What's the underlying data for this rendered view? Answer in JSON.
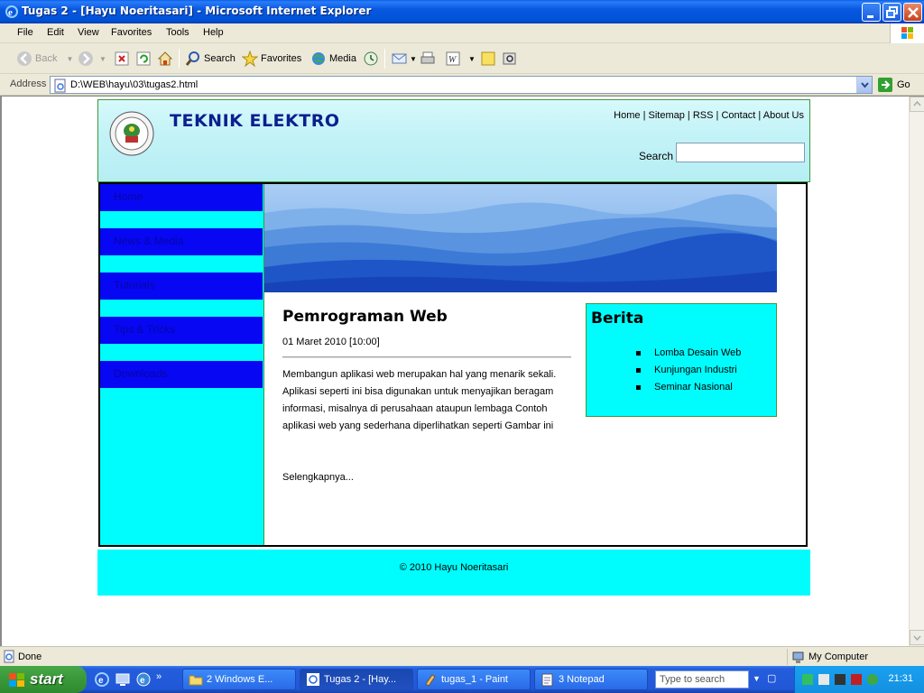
{
  "window": {
    "title": "Tugas 2 - [Hayu Noeritasari] - Microsoft Internet Explorer"
  },
  "menu": [
    "File",
    "Edit",
    "View",
    "Favorites",
    "Tools",
    "Help"
  ],
  "toolbar": {
    "back": "Back",
    "search": "Search",
    "favorites": "Favorites",
    "media": "Media"
  },
  "address": {
    "label": "Address",
    "url": "D:\\WEB\\hayu\\03\\tugas2.html",
    "go": "Go"
  },
  "site": {
    "title": "TEKNIK ELEKTRO",
    "top_links": [
      "Home",
      "Sitemap",
      "RSS",
      "Contact",
      "About Us"
    ],
    "search_label": "Search",
    "nav": [
      "Home",
      "News & Media",
      "Tutorials",
      "Tips & Tricks",
      "Downloads"
    ],
    "article": {
      "title": "Pemrograman Web",
      "date": "01 Maret 2010 [10:00]",
      "body": "Membangun aplikasi web merupakan hal yang menarik sekali. Aplikasi seperti ini bisa digunakan untuk menyajikan beragam informasi, misalnya di perusahaan ataupun lembaga Contoh aplikasi web yang sederhana diperlihatkan seperti Gambar ini",
      "read_more": "Selengkapnya..."
    },
    "news": {
      "title": "Berita",
      "items": [
        "Lomba Desain Web",
        "Kunjungan Industri",
        "Seminar Nasional"
      ]
    },
    "footer": "© 2010 Hayu Noeritasari"
  },
  "status": {
    "text": "Done",
    "zone": "My Computer"
  },
  "taskbar": {
    "start": "start",
    "tasks": [
      "2 Windows E...",
      "Tugas 2 - [Hay...",
      "tugas_1 - Paint",
      "3 Notepad"
    ],
    "search_placeholder": "Type to search",
    "clock": "21:31"
  },
  "colors": {
    "nav_blue": "#0707f3",
    "cyan": "#00fdfd",
    "title_blue": "#0b1f8f"
  }
}
